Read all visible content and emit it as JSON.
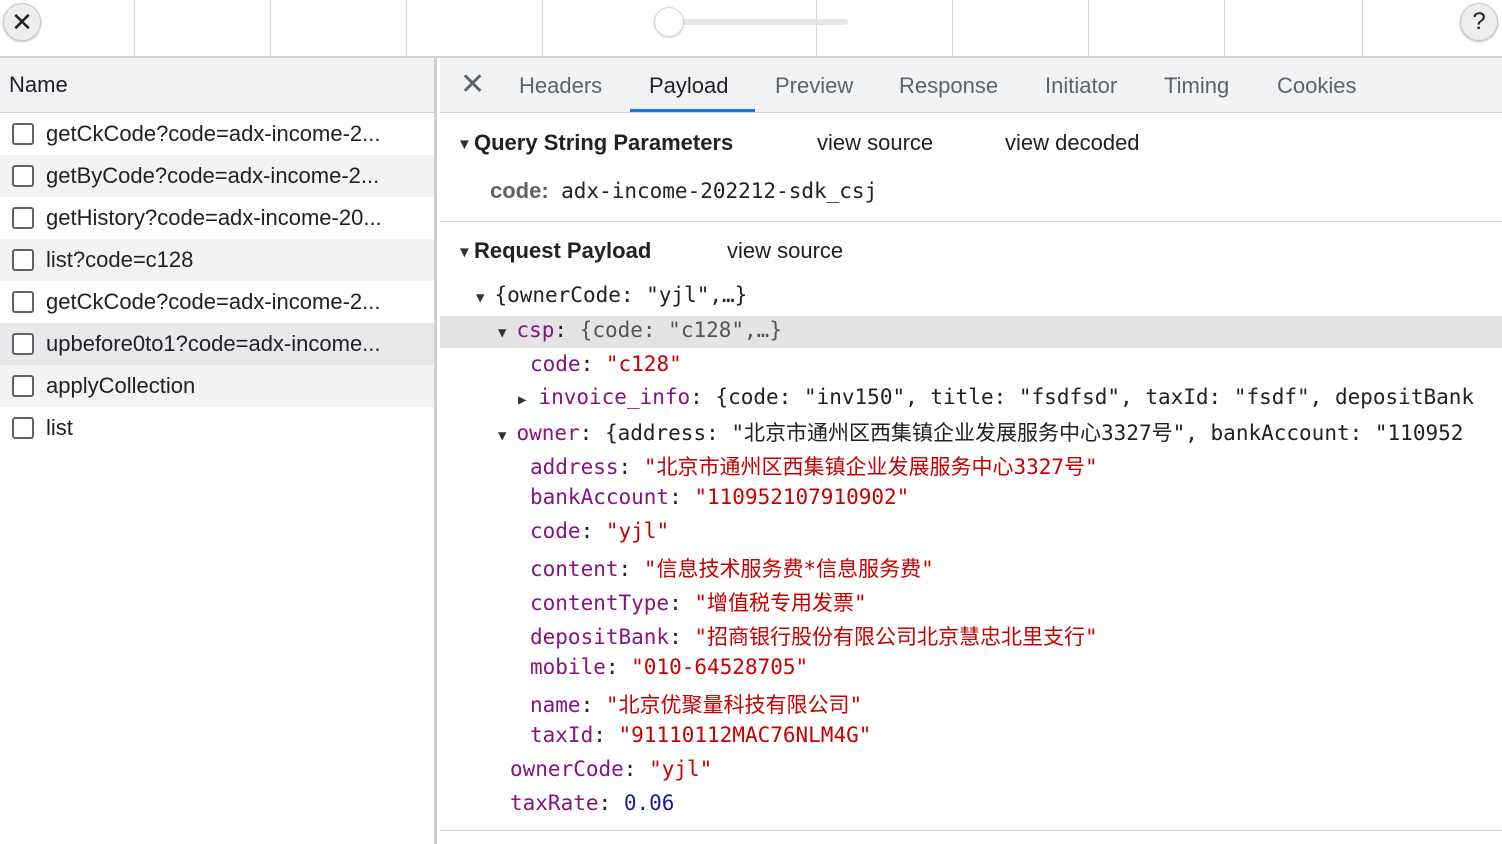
{
  "toolbar": {
    "close_glyph": "✕",
    "help_glyph": "?"
  },
  "left_panel": {
    "header": "Name",
    "requests": [
      {
        "name": "getCkCode?code=adx-income-2..."
      },
      {
        "name": "getByCode?code=adx-income-2..."
      },
      {
        "name": "getHistory?code=adx-income-20..."
      },
      {
        "name": "list?code=c128"
      },
      {
        "name": "getCkCode?code=adx-income-2..."
      },
      {
        "name": "upbefore0to1?code=adx-income..."
      },
      {
        "name": "applyCollection"
      },
      {
        "name": "list"
      }
    ]
  },
  "tabs": {
    "close_glyph": "✕",
    "items": [
      "Headers",
      "Payload",
      "Preview",
      "Response",
      "Initiator",
      "Timing",
      "Cookies"
    ],
    "active": "Payload"
  },
  "query_section": {
    "title": "Query String Parameters",
    "view_source": "view source",
    "view_decoded": "view decoded",
    "params": [
      {
        "key": "code:",
        "value": "adx-income-202212-sdk_csj"
      }
    ]
  },
  "payload_section": {
    "title": "Request Payload",
    "view_source": "view source",
    "root_summary": "{ownerCode: \"yjl\",…}",
    "csp": {
      "key": "csp",
      "summary": "{code: \"c128\",…}",
      "code_key": "code",
      "code_value": "\"c128\"",
      "invoice_key": "invoice_info",
      "invoice_summary": "{code: \"inv150\", title: \"fsdfsd\", taxId: \"fsdf\", depositBank"
    },
    "owner": {
      "key": "owner",
      "summary": "{address: \"北京市通州区西集镇企业发展服务中心3327号\", bankAccount: \"110952",
      "fields": [
        {
          "key": "address",
          "value": "\"北京市通州区西集镇企业发展服务中心3327号\""
        },
        {
          "key": "bankAccount",
          "value": "\"110952107910902\""
        },
        {
          "key": "code",
          "value": "\"yjl\""
        },
        {
          "key": "content",
          "value": "\"信息技术服务费*信息服务费\""
        },
        {
          "key": "contentType",
          "value": "\"增值税专用发票\""
        },
        {
          "key": "depositBank",
          "value": "\"招商银行股份有限公司北京慧忠北里支行\""
        },
        {
          "key": "mobile",
          "value": "\"010-64528705\""
        },
        {
          "key": "name",
          "value": "\"北京优聚量科技有限公司\""
        },
        {
          "key": "taxId",
          "value": "\"91110112MAC76NLM4G\""
        }
      ]
    },
    "ownerCode": {
      "key": "ownerCode",
      "value": "\"yjl\""
    },
    "taxRate": {
      "key": "taxRate",
      "value": "0.06"
    }
  },
  "colors": {
    "key": "#881280",
    "string": "#c80000",
    "number": "#1a1aa6",
    "tab_underline": "#1a73e8"
  }
}
